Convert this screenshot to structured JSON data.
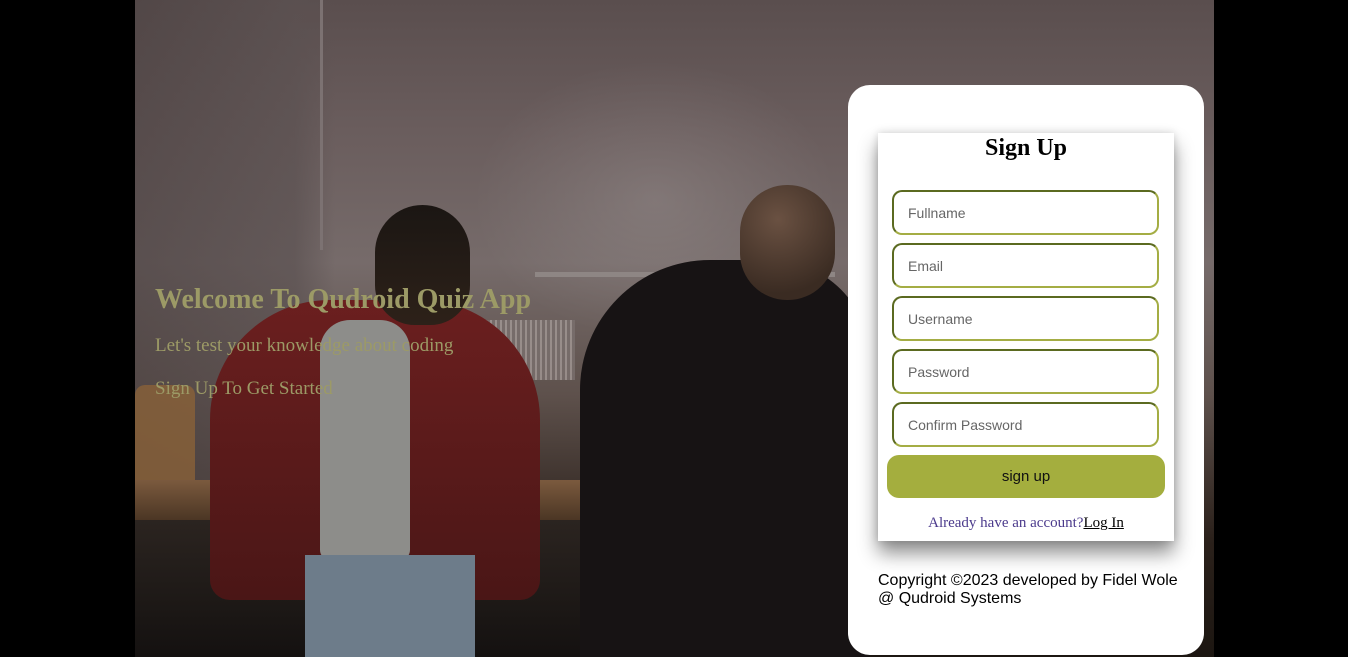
{
  "hero": {
    "title": "Welcome To Qudroid Quiz App",
    "subtitle": "Let's test your knowledge about coding",
    "cta": "Sign Up To Get Started"
  },
  "form": {
    "title": "Sign Up",
    "fields": {
      "fullname": {
        "placeholder": "Fullname",
        "value": ""
      },
      "email": {
        "placeholder": "Email",
        "value": ""
      },
      "username": {
        "placeholder": "Username",
        "value": ""
      },
      "password": {
        "placeholder": "Password",
        "value": ""
      },
      "confirm_password": {
        "placeholder": "Confirm Password",
        "value": ""
      }
    },
    "submit_label": "sign up",
    "login_prompt": "Already have an account?",
    "login_link": "Log In"
  },
  "footer": {
    "copyright": "Copyright ©2023 developed by Fidel Wole @ Qudroid Systems"
  },
  "colors": {
    "accent": "#a4ae3e",
    "hero_text": "#9c9a66",
    "login_prompt": "#4b3a8c"
  }
}
